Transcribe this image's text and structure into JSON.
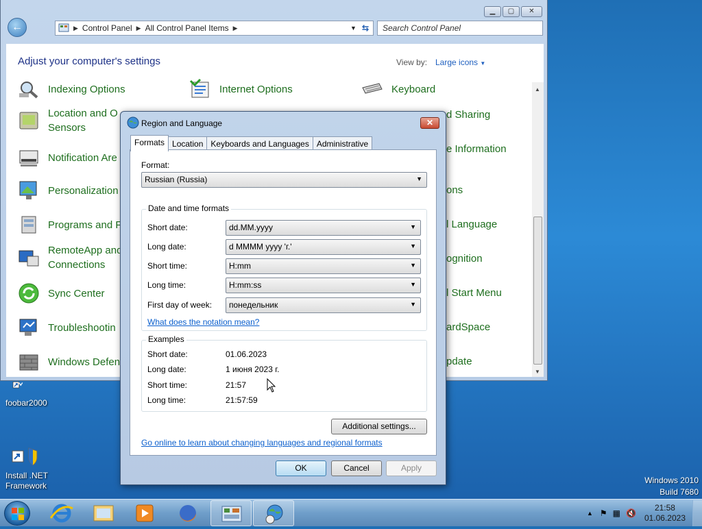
{
  "desktop": {
    "icons": [
      {
        "label": "foobar2000"
      },
      {
        "label": "Install .NET Framework"
      }
    ],
    "watermark": {
      "line1": "Windows 2010",
      "line2": "Build 7680"
    }
  },
  "control_panel": {
    "window_buttons": {
      "minimize": "▁",
      "maximize": "▢",
      "close": "✕"
    },
    "breadcrumb": [
      "Control Panel",
      "All Control Panel Items"
    ],
    "search_placeholder": "Search Control Panel",
    "heading": "Adjust your computer's settings",
    "view_by_label": "View by:",
    "view_by_value": "Large icons",
    "items_col1": [
      {
        "label": "Indexing Options"
      },
      {
        "label": "Location and Other Sensors",
        "line1": "Location and O",
        "line2": "Sensors"
      },
      {
        "label": "Notification Are"
      },
      {
        "label": "Personalization"
      },
      {
        "label": "Programs and F"
      },
      {
        "label": "RemoteApp and Connections",
        "line1": "RemoteApp and",
        "line2": "Connections"
      },
      {
        "label": "Sync Center"
      },
      {
        "label": "Troubleshootin"
      },
      {
        "label": "Windows Defen"
      }
    ],
    "items_col2": [
      {
        "label": "Internet Options"
      }
    ],
    "items_col3": [
      {
        "label": "Keyboard"
      },
      {
        "label": "d Sharing"
      },
      {
        "label": "e Information"
      },
      {
        "label": "ons"
      },
      {
        "label": "l Language"
      },
      {
        "label": "ognition"
      },
      {
        "label": "l Start Menu"
      },
      {
        "label": "ardSpace"
      },
      {
        "label": "pdate"
      }
    ]
  },
  "dialog": {
    "title": "Region and Language",
    "close": "✕",
    "tabs": [
      "Formats",
      "Location",
      "Keyboards and Languages",
      "Administrative"
    ],
    "format_label": "Format:",
    "format_value": "Russian (Russia)",
    "dt_group_title": "Date and time formats",
    "fields": [
      {
        "label": "Short date:",
        "value": "dd.MM.yyyy"
      },
      {
        "label": "Long date:",
        "value": "d MMMM yyyy 'г.'"
      },
      {
        "label": "Short time:",
        "value": "H:mm"
      },
      {
        "label": "Long time:",
        "value": "H:mm:ss"
      },
      {
        "label": "First day of week:",
        "value": "понедельник"
      }
    ],
    "notation_link": "What does the notation mean?",
    "examples_title": "Examples",
    "examples": [
      {
        "label": "Short date:",
        "value": "01.06.2023"
      },
      {
        "label": "Long date:",
        "value": "1 июня 2023 г."
      },
      {
        "label": "Short time:",
        "value": "21:57"
      },
      {
        "label": "Long time:",
        "value": "21:57:59"
      }
    ],
    "additional_settings": "Additional settings...",
    "online_link": "Go online to learn about changing languages and regional formats",
    "ok": "OK",
    "cancel": "Cancel",
    "apply": "Apply"
  },
  "taskbar": {
    "clock_time": "21:58",
    "clock_date": "01.06.2023"
  }
}
